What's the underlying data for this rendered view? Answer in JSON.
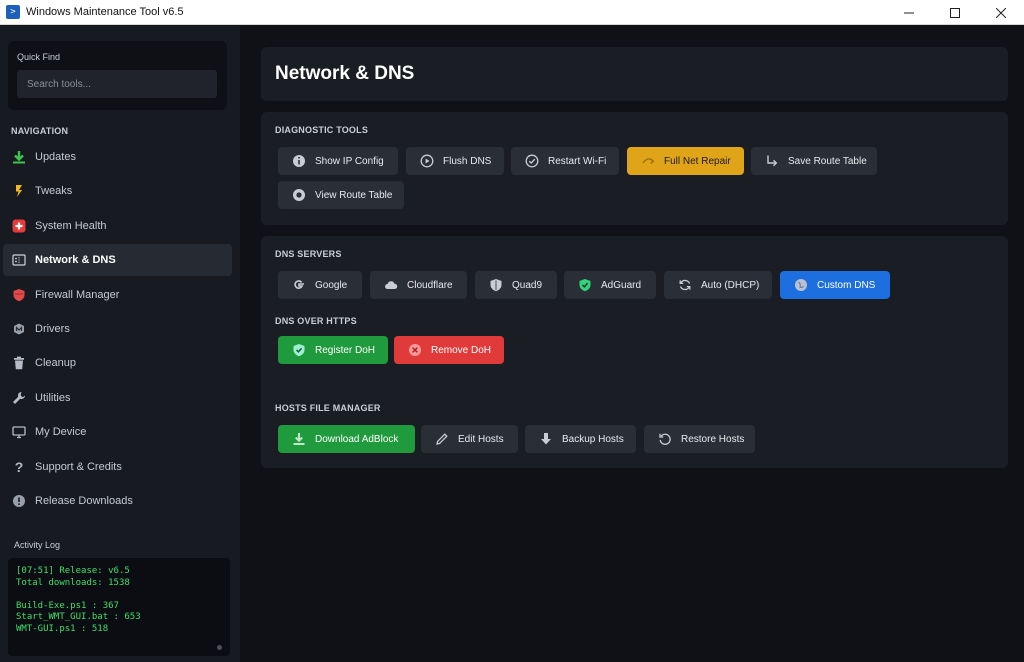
{
  "window": {
    "title": "Windows Maintenance Tool v6.5"
  },
  "sidebar": {
    "quick_find_label": "Quick Find",
    "search_placeholder": "Search tools...",
    "nav_heading": "NAVIGATION",
    "items": [
      {
        "label": "Updates",
        "icon": "download-arrow-icon"
      },
      {
        "label": "Tweaks",
        "icon": "lightning-icon"
      },
      {
        "label": "System Health",
        "icon": "health-cross-icon"
      },
      {
        "label": "Network & DNS",
        "icon": "network-icon",
        "active": true
      },
      {
        "label": "Firewall Manager",
        "icon": "shield-icon"
      },
      {
        "label": "Drivers",
        "icon": "chip-icon"
      },
      {
        "label": "Cleanup",
        "icon": "trash-icon"
      },
      {
        "label": "Utilities",
        "icon": "wrench-icon"
      },
      {
        "label": "My Device",
        "icon": "monitor-icon"
      },
      {
        "label": "Support & Credits",
        "icon": "question-icon"
      },
      {
        "label": "Release Downloads",
        "icon": "info-circle-icon"
      }
    ],
    "activity_label": "Activity Log",
    "log_lines": [
      "[07:51] Release: v6.5",
      "Total downloads: 1538",
      "",
      "Build-Exe.ps1 : 367",
      "Start_WMT_GUI.bat : 653",
      "WMT-GUI.ps1 : 518"
    ]
  },
  "main": {
    "page_title": "Network & DNS",
    "diagnostic": {
      "title": "DIAGNOSTIC TOOLS",
      "buttons": [
        {
          "label": "Show IP Config",
          "icon": "info-icon"
        },
        {
          "label": "Flush DNS",
          "icon": "play-circle-icon"
        },
        {
          "label": "Restart Wi-Fi",
          "icon": "check-circle-icon"
        },
        {
          "label": "Full Net Repair",
          "icon": "repair-icon"
        },
        {
          "label": "Save Route Table",
          "icon": "route-arrow-icon"
        },
        {
          "label": "View Route Table",
          "icon": "target-icon"
        }
      ]
    },
    "dns": {
      "title": "DNS SERVERS",
      "buttons": [
        {
          "label": "Google",
          "icon": "google-icon"
        },
        {
          "label": "Cloudflare",
          "icon": "cloud-icon"
        },
        {
          "label": "Quad9",
          "icon": "shield-icon"
        },
        {
          "label": "AdGuard",
          "icon": "shield-check-icon"
        },
        {
          "label": "Auto (DHCP)",
          "icon": "refresh-icon"
        },
        {
          "label": "Custom DNS",
          "icon": "globe-icon"
        }
      ]
    },
    "doh": {
      "title": "DNS OVER HTTPS",
      "buttons": [
        {
          "label": "Register DoH",
          "icon": "shield-check-icon"
        },
        {
          "label": "Remove DoH",
          "icon": "close-circle-icon"
        }
      ]
    },
    "hosts": {
      "title": "HOSTS FILE MANAGER",
      "buttons": [
        {
          "label": "Download AdBlock",
          "icon": "download-icon"
        },
        {
          "label": "Edit Hosts",
          "icon": "pencil-icon"
        },
        {
          "label": "Backup Hosts",
          "icon": "arrow-down-icon"
        },
        {
          "label": "Restore Hosts",
          "icon": "restore-icon"
        }
      ]
    }
  },
  "colors": {
    "accent_yellow": "#e0a418",
    "accent_blue": "#1d6fe0",
    "accent_green": "#1f9a3c",
    "accent_red": "#e03a3a",
    "log_text": "#3ee06a"
  }
}
